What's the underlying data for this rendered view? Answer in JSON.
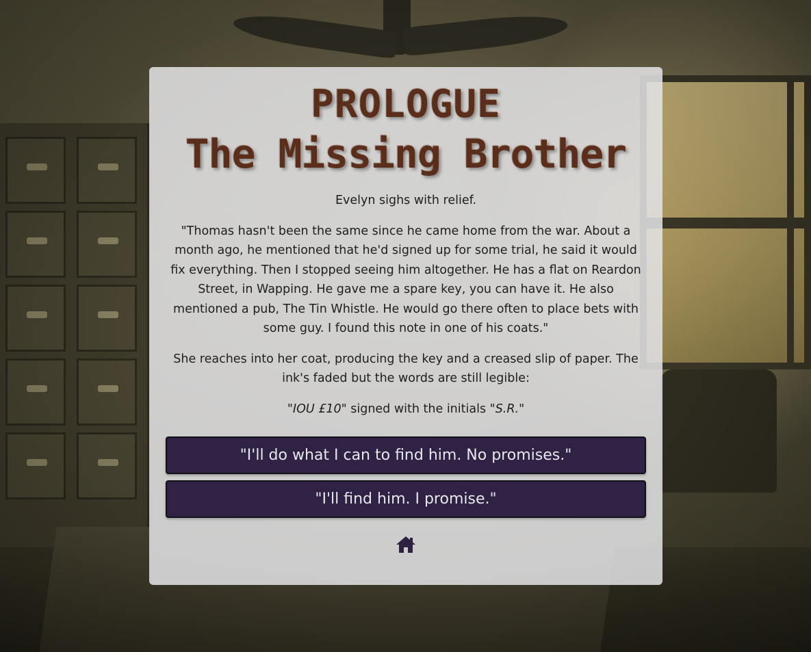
{
  "chapter": {
    "label": "PROLOGUE",
    "title": "The Missing Brother"
  },
  "story": {
    "intro": "Evelyn sighs with relief.",
    "dialogue": "\"Thomas hasn't been the same since he came home from the war. About a month ago, he mentioned that he'd signed up for some trial, he said it would fix everything. Then I stopped seeing him altogether. He has a flat on Reardon Street, in Wapping. He gave me a spare key, you can have it. He also mentioned a pub, The Tin Whistle. He would go there often to place bets with some guy. I found this note in one of his coats.\"",
    "action": "She reaches into her coat, producing the key and a creased slip of paper. The ink's faded but the words are still legible:",
    "note_text": "\"IOU £10\"",
    "note_middle": " signed with the initials ",
    "note_initials": "\"S.R.\""
  },
  "choices": [
    {
      "label": "\"I'll do what I can to find him. No promises.\""
    },
    {
      "label": "\"I'll find him. I promise.\""
    }
  ],
  "home": {
    "icon": "home-icon"
  },
  "colors": {
    "title": "#5a2e1a",
    "button_bg": "#302245",
    "button_text": "#e8e8ec",
    "home_icon": "#2e2240"
  }
}
